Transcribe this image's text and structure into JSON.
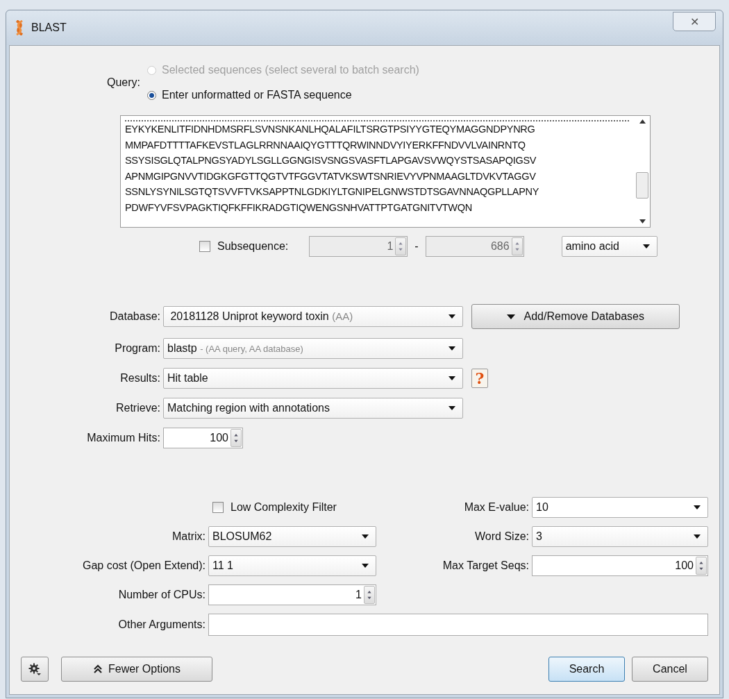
{
  "window": {
    "title": "BLAST",
    "close": "✕"
  },
  "query": {
    "label": "Query:",
    "options": [
      {
        "label": "Selected sequences (select several to batch search)",
        "selected": false,
        "disabled": true
      },
      {
        "label": "Enter unformatted or FASTA sequence",
        "selected": true,
        "disabled": false
      }
    ],
    "sequence_lines": [
      "EYKYKENLITFIDNHDMSRFLSVNSNKANLHQALAFILTSRGTPSIYYGTEQYMAGGNDPYNRG",
      "MMPAFDTTTTAFKEVSTLAGLRRNNAAIQYGTTTQRWINNDVYIYERKFFNDVVLVAINRNTQ",
      "SSYSISGLQTALPNGSYADYLSGLLGGNGISVSNGSVASFTLAPGAVSVWQYSTSASAPQIGSV",
      "APNMGIPGNVVTIDGKGFGTTQGTVTFGGVTATVKSWTSNRIEVYVPNMAAGLTDVKVTAGGV",
      "SSNLYSYNILSGTQTSVVFTVKSAPPTNLGDKIYLTGNIPELGNWSTDTSGAVNNAQGPLLAPNY",
      "PDWFYVFSVPAGKTIQFKFFIKRADGTIQWENGSNHVATTPTGATGNITVTWQN"
    ]
  },
  "subsequence": {
    "label": "Subsequence:",
    "checked": false,
    "from": "1",
    "dash": "-",
    "to": "686",
    "type": "amino acid"
  },
  "database": {
    "label": "Database:",
    "value": "20181128 Uniprot keyword toxin",
    "hint": "(AA)",
    "button": "Add/Remove Databases"
  },
  "program": {
    "label": "Program:",
    "value": "blastp",
    "hint": "- (AA query, AA database)"
  },
  "results": {
    "label": "Results:",
    "value": "Hit table",
    "help": "?"
  },
  "retrieve": {
    "label": "Retrieve:",
    "value": "Matching region with annotations"
  },
  "max_hits": {
    "label": "Maximum Hits:",
    "value": "100"
  },
  "advanced": {
    "low_complexity": {
      "label": "Low Complexity Filter",
      "checked": false
    },
    "matrix": {
      "label": "Matrix:",
      "value": "BLOSUM62"
    },
    "gap_cost": {
      "label": "Gap cost (Open Extend):",
      "value": "11 1"
    },
    "cpus": {
      "label": "Number of CPUs:",
      "value": "1"
    },
    "other_arguments": {
      "label": "Other Arguments:"
    },
    "max_evalue": {
      "label": "Max E-value:",
      "value": "10"
    },
    "word_size": {
      "label": "Word Size:",
      "value": "3"
    },
    "max_target_seqs": {
      "label": "Max Target Seqs:",
      "value": "100"
    }
  },
  "buttons": {
    "fewer_options": "Fewer Options",
    "search": "Search",
    "cancel": "Cancel"
  }
}
